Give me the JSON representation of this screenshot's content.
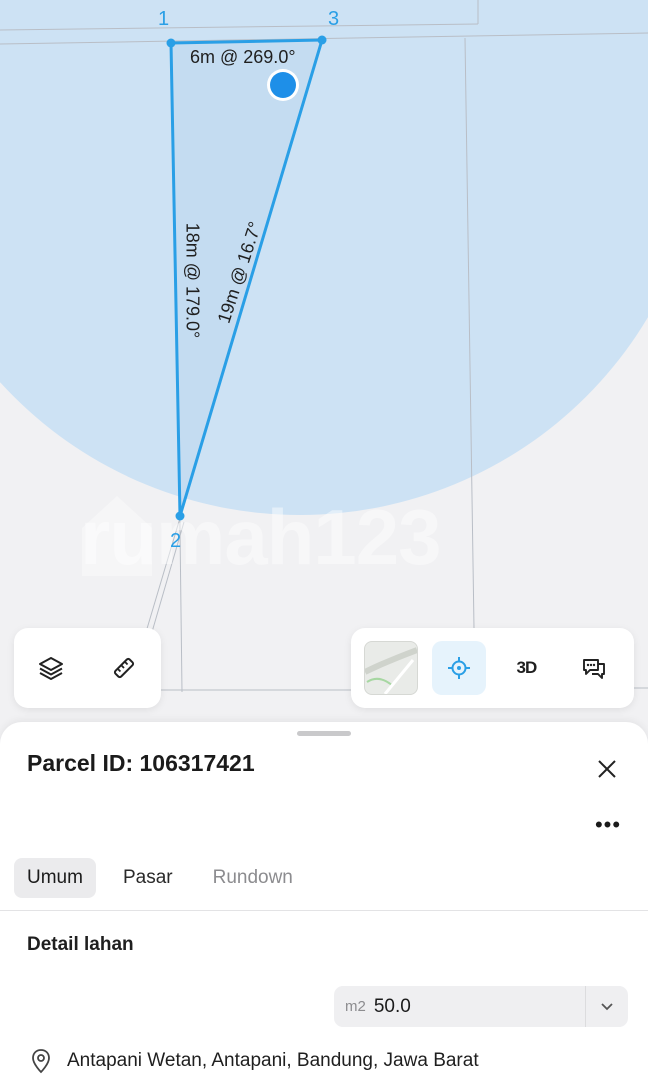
{
  "map": {
    "vertices": [
      {
        "id": "vertex-1",
        "label": "1"
      },
      {
        "id": "vertex-2",
        "label": "2"
      },
      {
        "id": "vertex-3",
        "label": "3"
      }
    ],
    "edges": {
      "top": "6m @ 269.0°",
      "left": "18m @ 179.0°",
      "diagonal": "19m @ 16.7°"
    },
    "watermark": "rumah123",
    "colors": {
      "accuracy_circle": "#cde2f4",
      "parcel_line": "#2a9fe6",
      "location_dot": "#1e8fe8"
    }
  },
  "toolbar_left": {
    "icons": [
      "layers-icon",
      "measure-icon"
    ]
  },
  "toolbar_right": {
    "label_3d": "3D",
    "icons": [
      "satellite-thumbnail",
      "locate-icon",
      "3d-toggle",
      "feedback-icon"
    ]
  },
  "sheet": {
    "title": "Parcel ID: 106317421",
    "more_label": "•••",
    "tabs": [
      {
        "label": "Umum",
        "state": "selected"
      },
      {
        "label": "Pasar",
        "state": "normal"
      },
      {
        "label": "Rundown",
        "state": "muted"
      }
    ],
    "section_title": "Detail lahan",
    "area_unit": "m2",
    "area_value": "50.0",
    "address": "Antapani Wetan, Antapani, Bandung, Jawa Barat"
  }
}
